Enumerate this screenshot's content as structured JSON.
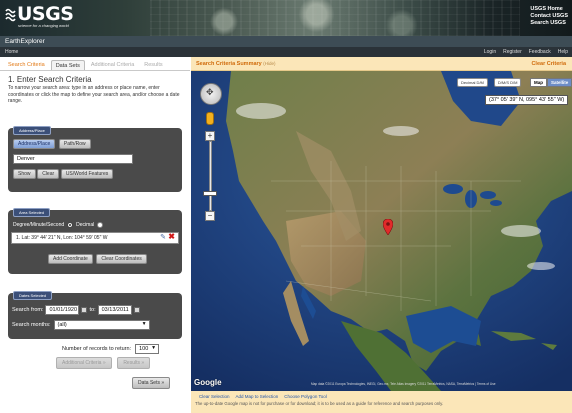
{
  "header": {
    "logo": "USGS",
    "tagline": "science for a changing world",
    "links": [
      "USGS Home",
      "Contact USGS",
      "Search USGS"
    ]
  },
  "app": {
    "title": "EarthExplorer"
  },
  "nav": {
    "home": "Home",
    "right": [
      "Login",
      "Register",
      "Feedback",
      "Help"
    ]
  },
  "tabs": [
    "Search Criteria",
    "Data Sets",
    "Additional Criteria",
    "Results"
  ],
  "step": {
    "title": "1. Enter Search Criteria",
    "instructions": "To narrow your search area: type in an address or place name, enter coordinates or click the map to define your search area, and/or choose a date range."
  },
  "address": {
    "group_label": "Address/Place",
    "tab_address": "Address/Place",
    "tab_pathrow": "Path/Row",
    "input_value": "Denver",
    "show": "Show",
    "clear": "Clear",
    "features": "US/World Features"
  },
  "area": {
    "group_label": "Area Selected",
    "dms_label": "Degree/Minute/Second",
    "decimal_label": "Decimal",
    "coordinate": "1.  Lat: 39° 44' 21\" N, Lon: 104° 59' 05\" W",
    "add": "Add Coordinate",
    "clear": "Clear Coordinates"
  },
  "dates": {
    "group_label": "Dates Selected",
    "search_from_label": "Search from:",
    "from_value": "01/01/1920",
    "to_label": "to:",
    "to_value": "03/13/2011",
    "months_label": "Search months:",
    "months_value": "(all)"
  },
  "records": {
    "label": "Number of records to return:",
    "value": "100"
  },
  "actions": {
    "additional": "Additional Criteria »",
    "results": "Results »",
    "datasets": "Data Sets »"
  },
  "summary": {
    "title": "Search Criteria Summary",
    "hide": "(Hide)",
    "clear_all": "Clear Criteria"
  },
  "map": {
    "toggles": [
      "Decimal D/M",
      "D/M/S D/M"
    ],
    "types": [
      "Map",
      "Satellite"
    ],
    "coordinate_readout": "(37° 05' 39\" N, 095° 43' 55\" W)",
    "google": "Google",
    "attribution": "Map data ©2011 Europa Technologies, INEGI, Geo.mx, Tele Atlas Imagery ©2011 TerraMetrics, NASA, TerraMetrics | Terms of Use",
    "links": [
      "Clear Selection",
      "Add Map to Selection",
      "Choose Polygon Tool"
    ],
    "note": "The up-to-date Google map is not for purchase or for download; it is to be used as a guide for reference and search purposes only."
  },
  "colors": {
    "accent_orange": "#d06b0b",
    "group_bg": "#4a4a4a",
    "label_blue": "#3b4f78",
    "summary_bg": "#fbe6b8"
  }
}
